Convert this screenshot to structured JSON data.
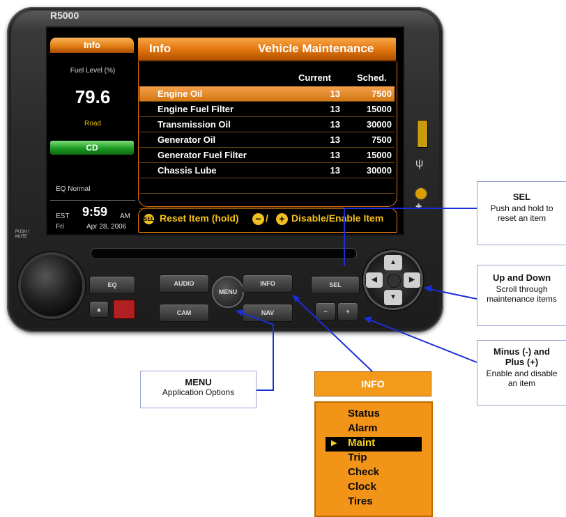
{
  "device": {
    "model": "R5000",
    "left_panel": {
      "tab_label": "Info",
      "fuel_label": "Fuel Level (%)",
      "fuel_value": "79.6",
      "mode_label": "Road",
      "cd_label": "CD",
      "eq_status": "EQ Normal",
      "timezone": "EST",
      "time": "9:59",
      "ampm": "AM",
      "day": "Fri",
      "date": "Apr 28, 2006"
    },
    "main_panel": {
      "section": "Info",
      "title": "Vehicle Maintenance",
      "columns": {
        "current": "Current",
        "sched": "Sched."
      },
      "rows": [
        {
          "name": "Engine Oil",
          "current": "13",
          "sched": "7500",
          "selected": true
        },
        {
          "name": "Engine Fuel Filter",
          "current": "13",
          "sched": "15000",
          "selected": false
        },
        {
          "name": "Transmission Oil",
          "current": "13",
          "sched": "30000",
          "selected": false
        },
        {
          "name": "Generator Oil",
          "current": "13",
          "sched": "7500",
          "selected": false
        },
        {
          "name": "Generator Fuel Filter",
          "current": "13",
          "sched": "15000",
          "selected": false
        },
        {
          "name": "Chassis Lube",
          "current": "13",
          "sched": "30000",
          "selected": false
        }
      ],
      "help": {
        "sel_icon": "SEL",
        "reset_text": "Reset Item (hold)",
        "minus_icon": "−",
        "slash": "/",
        "plus_icon": "+",
        "disable_text": "Disable/Enable Item"
      }
    },
    "controls": {
      "push_mute": "PUSH / MUTE",
      "eq": "EQ",
      "audio": "AUDIO",
      "menu": "MENU",
      "info": "INFO",
      "sel": "SEL",
      "cam": "CAM",
      "nav": "NAV",
      "minus": "−",
      "plus": "+",
      "eject": "▲",
      "dpad_up": "▲",
      "dpad_down": "▼",
      "dpad_left": "◀",
      "dpad_right": "▶"
    }
  },
  "callouts": {
    "sel": {
      "title": "SEL",
      "text": "Push and hold to reset an item"
    },
    "updown": {
      "title": "Up and Down",
      "text": "Scroll through maintenance items"
    },
    "minusplus": {
      "title": "Minus (-) and Plus (+)",
      "text": "Enable and disable an item"
    },
    "menu": {
      "title": "MENU",
      "text": "Application Options"
    }
  },
  "info_menu": {
    "label": "INFO",
    "items": [
      "Status",
      "Alarm",
      "Maint",
      "Trip",
      "Check",
      "Clock",
      "Tires"
    ],
    "selected_index": 2,
    "pointer": "▶"
  },
  "colors": {
    "accent_orange": "#e57710",
    "help_yellow": "#f6c21a",
    "callout_line": "#1a2fd8",
    "cd_green": "#1c9a22"
  }
}
